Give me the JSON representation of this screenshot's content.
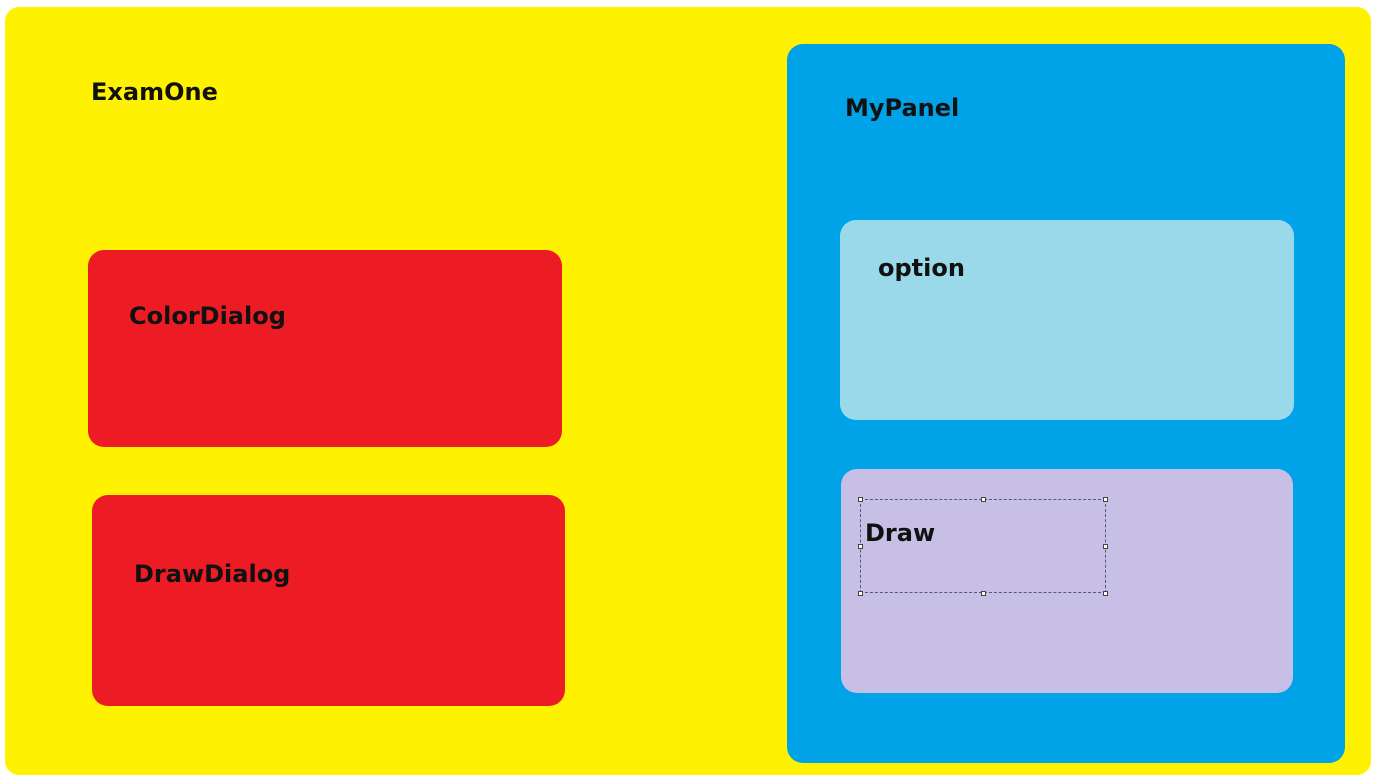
{
  "colors": {
    "exam_one_bg": "#fff200",
    "dialog_bg": "#ed1c24",
    "panel_bg": "#00a2e8",
    "option_bg": "#99d9ea",
    "draw_bg": "#c8bfe7"
  },
  "exam_one": {
    "label": "ExamOne"
  },
  "color_dialog": {
    "label": "ColorDialog"
  },
  "draw_dialog": {
    "label": "DrawDialog"
  },
  "my_panel": {
    "label": "MyPanel",
    "option": {
      "label": "option"
    },
    "draw": {
      "label": "Draw"
    }
  }
}
